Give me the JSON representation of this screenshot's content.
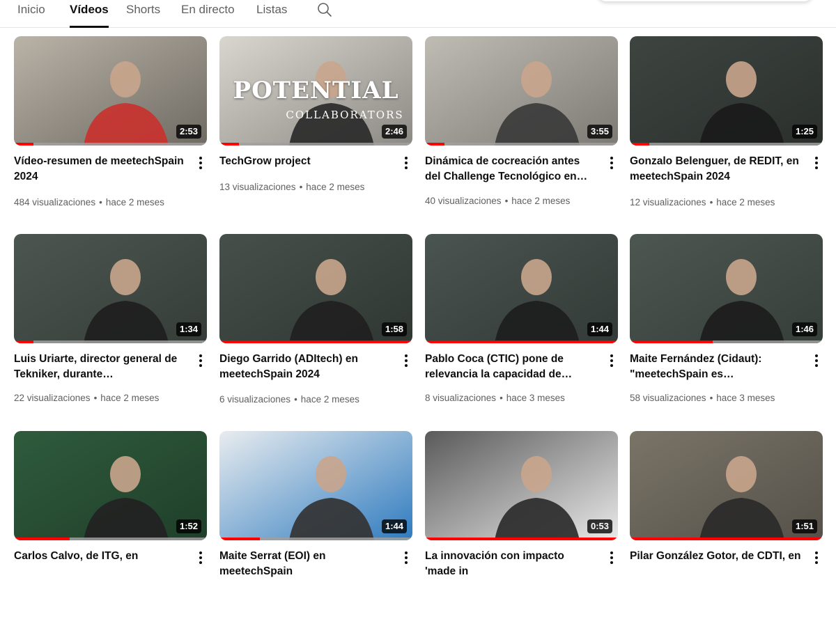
{
  "tabs": [
    {
      "label": "Inicio",
      "active": false
    },
    {
      "label": "Vídeos",
      "active": true
    },
    {
      "label": "Shorts",
      "active": false
    },
    {
      "label": "En directo",
      "active": false
    },
    {
      "label": "Listas",
      "active": false
    }
  ],
  "search_icon": "search-icon",
  "meta_separator": "•",
  "videos": [
    {
      "title": "Vídeo-resumen de meetechSpain 2024",
      "views": "484 visualizaciones",
      "age": "hace 2 meses",
      "duration": "2:53",
      "watched_fraction": 0.1,
      "overlay_text": ""
    },
    {
      "title": "TechGrow project",
      "views": "13 visualizaciones",
      "age": "hace 2 meses",
      "duration": "2:46",
      "watched_fraction": 0.1,
      "overlay_text": "POTENTIAL",
      "overlay_subtext": "COLLABORATORS"
    },
    {
      "title": "Dinámica de cocreación antes del Challenge Tecnológico en…",
      "views": "40 visualizaciones",
      "age": "hace 2 meses",
      "duration": "3:55",
      "watched_fraction": 0.1,
      "overlay_text": ""
    },
    {
      "title": "Gonzalo Belenguer, de REDIT, en meetechSpain 2024",
      "views": "12 visualizaciones",
      "age": "hace 2 meses",
      "duration": "1:25",
      "watched_fraction": 0.1,
      "overlay_text": ""
    },
    {
      "title": "Luis Uriarte, director general de Tekniker, durante meetechSpain…",
      "views": "22 visualizaciones",
      "age": "hace 2 meses",
      "duration": "1:34",
      "watched_fraction": 0.1,
      "overlay_text": ""
    },
    {
      "title": "Diego Garrido (ADItech) en meetechSpain 2024",
      "views": "6 visualizaciones",
      "age": "hace 2 meses",
      "duration": "1:58",
      "watched_fraction": 1.0,
      "overlay_text": ""
    },
    {
      "title": "Pablo Coca (CTIC) pone de relevancia la capacidad de…",
      "views": "8 visualizaciones",
      "age": "hace 3 meses",
      "duration": "1:44",
      "watched_fraction": 1.0,
      "overlay_text": ""
    },
    {
      "title": "Maite Fernández (Cidaut): \"meetechSpain es transferencia,…",
      "views": "58 visualizaciones",
      "age": "hace 3 meses",
      "duration": "1:46",
      "watched_fraction": 0.43,
      "overlay_text": ""
    },
    {
      "title": "Carlos Calvo, de ITG, en",
      "views": "",
      "age": "",
      "duration": "1:52",
      "watched_fraction": 0.29,
      "overlay_text": ""
    },
    {
      "title": "Maite Serrat (EOI) en meetechSpain",
      "views": "",
      "age": "",
      "duration": "1:44",
      "watched_fraction": 0.21,
      "overlay_text": ""
    },
    {
      "title": "La innovación con impacto 'made in",
      "views": "",
      "age": "",
      "duration": "0:53",
      "watched_fraction": 1.0,
      "overlay_text": ""
    },
    {
      "title": "Pilar González Gotor, de CDTI, en",
      "views": "",
      "age": "",
      "duration": "1:51",
      "watched_fraction": 1.0,
      "overlay_text": ""
    }
  ],
  "colors": {
    "progress": "#ff0000",
    "muted_text": "#606060",
    "text": "#0f0f0f"
  }
}
